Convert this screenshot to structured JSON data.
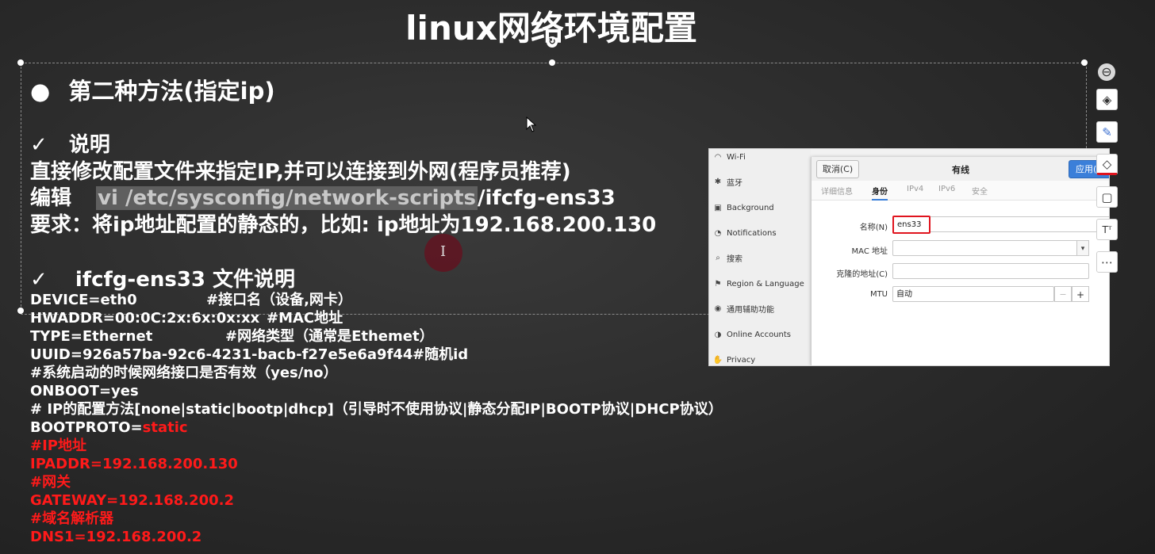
{
  "slide": {
    "title": "linux网络环境配置",
    "bullet_heading": "第二种方法(指定ip)",
    "section1": {
      "check": "✓",
      "heading": "说明",
      "line1": "直接修改配置文件来指定IP,并可以连接到外网(程序员推荐)",
      "line2_prefix": "编辑",
      "line2_highlight": "vi /etc/sysconfig/network-scripts",
      "line2_suffix": "/ifcfg-ens33",
      "line3": "要求：将ip地址配置的静态的，比如: ip地址为192.168.200.130"
    },
    "section2": {
      "check": "✓",
      "heading": "ifcfg-ens33 文件说明",
      "lines": [
        {
          "text": "DEVICE=eth0",
          "comment": "#接口名（设备,网卡）"
        },
        {
          "text": "HWADDR=00:0C:2x:6x:0x:xx",
          "comment": "#MAC地址"
        },
        {
          "text": "TYPE=Ethernet",
          "comment": "#网络类型（通常是Ethemet）"
        },
        {
          "text": "UUID=926a57ba-92c6-4231-bacb-f27e5e6a9f44",
          "comment": "#随机id"
        },
        {
          "text": "#系统启动的时候网络接口是否有效（yes/no）"
        },
        {
          "text": "ONBOOT=yes"
        },
        {
          "text": "# IP的配置方法[none|static|bootp|dhcp]（引导时不使用协议|静态分配IP|BOOTP协议|DHCP协议）"
        },
        {
          "text": "BOOTPROTO=",
          "red": "static"
        }
      ],
      "red_lines": [
        "#IP地址",
        "IPADDR=192.168.200.130",
        "#网关",
        "GATEWAY=192.168.200.2",
        "#域名解析器",
        "DNS1=192.168.200.2"
      ]
    }
  },
  "settings_shot": {
    "sidebar": [
      {
        "icon": "wifi-icon",
        "glyph": "◠",
        "label": "Wi-Fi"
      },
      {
        "icon": "bluetooth-icon",
        "glyph": "✱",
        "label": "蓝牙"
      },
      {
        "icon": "background-icon",
        "glyph": "▣",
        "label": "Background"
      },
      {
        "icon": "bell-icon",
        "glyph": "◔",
        "label": "Notifications"
      },
      {
        "icon": "search-icon",
        "glyph": "⌕",
        "label": "搜索"
      },
      {
        "icon": "flag-icon",
        "glyph": "⚑",
        "label": "Region & Language"
      },
      {
        "icon": "accessibility-icon",
        "glyph": "◉",
        "label": "通用辅助功能"
      },
      {
        "icon": "accounts-icon",
        "glyph": "◑",
        "label": "Online Accounts"
      },
      {
        "icon": "hand-icon",
        "glyph": "✋",
        "label": "Privacy"
      }
    ],
    "dialog": {
      "cancel": "取消(C)",
      "title": "有线",
      "apply": "应用(",
      "tabs": [
        "详细信息",
        "身份",
        "IPv4",
        "IPv6",
        "安全"
      ],
      "active_tab": "身份",
      "fields": [
        {
          "label": "名称(N)",
          "value": "ens33"
        },
        {
          "label": "MAC 地址",
          "value": ""
        },
        {
          "label": "克隆的地址(C)",
          "value": ""
        },
        {
          "label": "MTU",
          "value": "自动"
        }
      ],
      "dropdown_glyph": "▾",
      "minus": "−",
      "plus": "+"
    }
  },
  "right_toolbar": [
    {
      "name": "minus-circle-icon",
      "glyph": "⊖"
    },
    {
      "name": "layers-icon",
      "glyph": "◈"
    },
    {
      "name": "pen-icon",
      "glyph": "✎"
    },
    {
      "name": "fill-icon",
      "glyph": "◇"
    },
    {
      "name": "frame-icon",
      "glyph": "▢"
    },
    {
      "name": "text-box-icon",
      "glyph": "Tᵀ"
    },
    {
      "name": "more-icon",
      "glyph": "⋯"
    }
  ],
  "text_cursor": "I",
  "rotate_glyph": "↻",
  "colors": {
    "accent_red": "#ff1a1a",
    "apply_blue": "#3b7fd9",
    "highlight_border": "#e0141e"
  }
}
